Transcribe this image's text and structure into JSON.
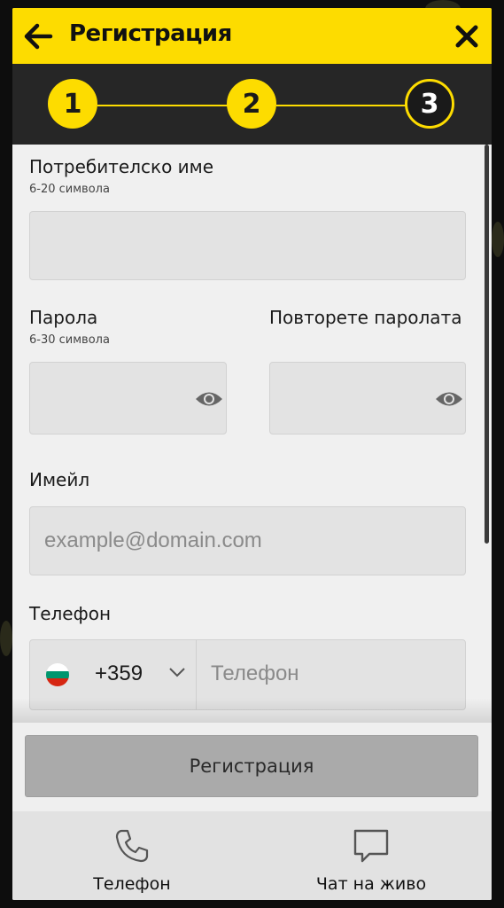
{
  "header": {
    "title": "Регистрация"
  },
  "steps": [
    {
      "number": "1",
      "state": "done"
    },
    {
      "number": "2",
      "state": "done"
    },
    {
      "number": "3",
      "state": "active"
    }
  ],
  "form": {
    "username": {
      "label": "Потребителско име",
      "hint": "6-20 символа",
      "value": ""
    },
    "password": {
      "label": "Парола",
      "hint": "6-30 символа",
      "value": ""
    },
    "password_repeat": {
      "label": "Повторете паролата",
      "value": ""
    },
    "email": {
      "label": "Имейл",
      "placeholder": "example@domain.com",
      "value": ""
    },
    "phone": {
      "label": "Телефон",
      "country_code": "+359",
      "country": "Bulgaria",
      "placeholder": "Телефон",
      "value": ""
    }
  },
  "submit_label": "Регистрация",
  "bottom_nav": [
    {
      "label": "Телефон",
      "icon": "phone-icon"
    },
    {
      "label": "Чат на живо",
      "icon": "chat-icon"
    }
  ],
  "colors": {
    "accent": "#fddc00",
    "dark": "#262626",
    "field_bg": "#e3e3e3",
    "button_disabled": "#aaaaaa"
  }
}
